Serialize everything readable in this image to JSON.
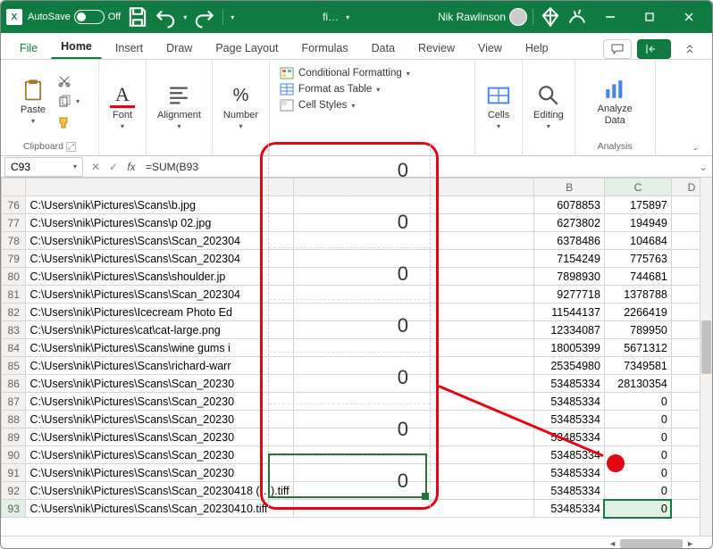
{
  "title": {
    "autosave_label": "AutoSave",
    "autosave_state": "Off",
    "doc_title": "fi…",
    "user_name": "Nik Rawlinson"
  },
  "tabs": {
    "file": "File",
    "home": "Home",
    "insert": "Insert",
    "draw": "Draw",
    "layout": "Page Layout",
    "formulas": "Formulas",
    "data": "Data",
    "review": "Review",
    "view": "View",
    "help": "Help"
  },
  "ribbon": {
    "clipboard": {
      "paste": "Paste",
      "label": "Clipboard"
    },
    "font": "Font",
    "alignment": "Alignment",
    "number": "Number",
    "styles": {
      "cond": "Conditional Formatting",
      "table": "Format as Table",
      "cell": "Cell Styles"
    },
    "cells": "Cells",
    "editing": "Editing",
    "analyze": "Analyze Data",
    "analysis_label": "Analysis"
  },
  "namebox": "C93",
  "formula": "=SUM(B93",
  "col_headers": {
    "B": "B",
    "C": "C",
    "D": "D"
  },
  "rows": [
    {
      "r": 76,
      "a": "C:\\Users\\nik\\Pictures\\Scans\\b.jpg",
      "b": "6078853",
      "c": "175897"
    },
    {
      "r": 77,
      "a": "C:\\Users\\nik\\Pictures\\Scans\\p 02.jpg",
      "b": "6273802",
      "c": "194949"
    },
    {
      "r": 78,
      "a": "C:\\Users\\nik\\Pictures\\Scans\\Scan_202304",
      "b": "6378486",
      "c": "104684"
    },
    {
      "r": 79,
      "a": "C:\\Users\\nik\\Pictures\\Scans\\Scan_202304",
      "b": "7154249",
      "c": "775763"
    },
    {
      "r": 80,
      "a": "C:\\Users\\nik\\Pictures\\Scans\\shoulder.jp",
      "b": "7898930",
      "c": "744681"
    },
    {
      "r": 81,
      "a": "C:\\Users\\nik\\Pictures\\Scans\\Scan_202304",
      "b": "9277718",
      "c": "1378788"
    },
    {
      "r": 82,
      "a": "C:\\Users\\nik\\Pictures\\Icecream Photo Ed",
      "b": "11544137",
      "c": "2266419"
    },
    {
      "r": 83,
      "a": "C:\\Users\\nik\\Pictures\\cat\\cat-large.png",
      "b": "12334087",
      "c": "789950"
    },
    {
      "r": 84,
      "a": "C:\\Users\\nik\\Pictures\\Scans\\wine gums i",
      "b": "18005399",
      "c": "5671312"
    },
    {
      "r": 85,
      "a": "C:\\Users\\nik\\Pictures\\Scans\\richard-warr",
      "b": "25354980",
      "c": "7349581"
    },
    {
      "r": 86,
      "a": "C:\\Users\\nik\\Pictures\\Scans\\Scan_20230",
      "b": "53485334",
      "c": "28130354"
    },
    {
      "r": 87,
      "a": "C:\\Users\\nik\\Pictures\\Scans\\Scan_20230",
      "b": "53485334",
      "c": "0"
    },
    {
      "r": 88,
      "a": "C:\\Users\\nik\\Pictures\\Scans\\Scan_20230",
      "b": "53485334",
      "c": "0"
    },
    {
      "r": 89,
      "a": "C:\\Users\\nik\\Pictures\\Scans\\Scan_20230",
      "b": "53485334",
      "c": "0"
    },
    {
      "r": 90,
      "a": "C:\\Users\\nik\\Pictures\\Scans\\Scan_20230",
      "b": "53485334",
      "c": "0"
    },
    {
      "r": 91,
      "a": "C:\\Users\\nik\\Pictures\\Scans\\Scan_20230",
      "b": "53485334",
      "c": "0"
    },
    {
      "r": 92,
      "a": "C:\\Users\\nik\\Pictures\\Scans\\Scan_20230418 (…).tiff",
      "b": "53485334",
      "c": "0"
    },
    {
      "r": 93,
      "a": "C:\\Users\\nik\\Pictures\\Scans\\Scan_20230410.tiff",
      "b": "53485334",
      "c": "0"
    }
  ],
  "callout_values": [
    "0",
    "0",
    "0",
    "0",
    "0",
    "0",
    "0"
  ],
  "active_cell": "C93"
}
